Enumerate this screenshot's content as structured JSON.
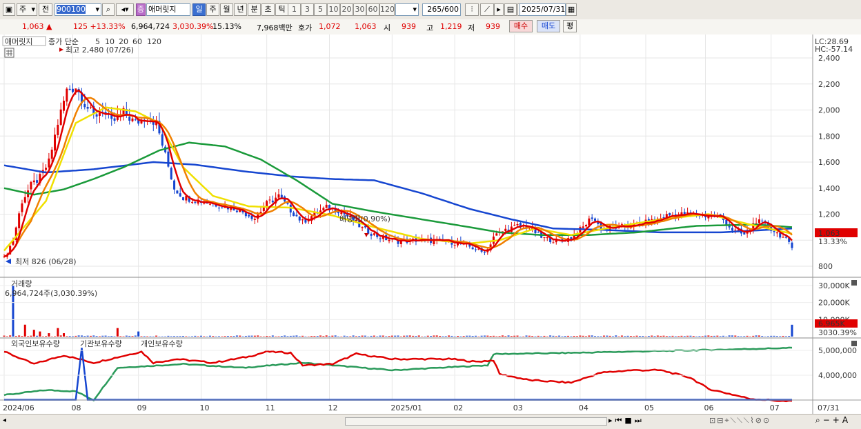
{
  "toolbar": {
    "period_options": [
      "주",
      "전"
    ],
    "code": "900100",
    "stock_tag": "증",
    "stock_name": "애머릿지",
    "intervals": [
      "일",
      "주",
      "월",
      "년",
      "분",
      "초",
      "틱"
    ],
    "numbers": [
      "1",
      "3",
      "5",
      "10",
      "20",
      "30",
      "60",
      "120"
    ],
    "count": "265",
    "count_total": "/600",
    "date": "2025/07/31"
  },
  "quote": {
    "price": "1,063 ▲",
    "change": "125 +13.33%",
    "volume": "6,964,724",
    "volume_ratio": "3,030.39%",
    "turnover": "15.13%",
    "amount": "7,968백만",
    "hoga_label": "호가",
    "ask": "1,072",
    "bid": "1,063",
    "open_label": "시",
    "open": "939",
    "high_label": "고",
    "high": "1,219",
    "low_label": "저",
    "low": "939",
    "buy_button": "매수",
    "sell_button": "매도",
    "eval_button": "평"
  },
  "price_panel": {
    "name_label": "애머릿지",
    "legend_label": "종가 단순",
    "ma_periods": [
      {
        "label": "5",
        "color": "#e00000"
      },
      {
        "label": "10",
        "color": "#f08000"
      },
      {
        "label": "20",
        "color": "#e8d800"
      },
      {
        "label": "60",
        "color": "#1a9a3a"
      },
      {
        "label": "120",
        "color": "#1646d0"
      }
    ],
    "high_annotation": "최고 2,480 (07/26)",
    "low_annotation": "최저 826 (06/28)",
    "dividend_annotation": "배당락(0.90%)",
    "lc_label": "LC:28.69",
    "hc_label": "HC:-57.14",
    "y_ticks": [
      "2,400",
      "2,200",
      "2,000",
      "1,800",
      "1,600",
      "1,400",
      "1,200",
      "800"
    ],
    "current_price_box": "1,063",
    "current_change_box": "13.33%"
  },
  "volume_panel": {
    "title": "거래량",
    "value_label": "6,964,724주(3,030.39%)",
    "y_ticks": [
      "30,000K",
      "20,000K",
      "10,000K"
    ],
    "current_box": "6,965K",
    "current_pct": "3030.39%"
  },
  "holding_panel": {
    "legends": [
      {
        "label": "외국인보유수량",
        "color": "#e00000"
      },
      {
        "label": "기관보유수량",
        "color": "#1646d0"
      },
      {
        "label": "개인보유수량",
        "color": "#1a9a3a"
      }
    ],
    "y_ticks": [
      "5,000,000",
      "4,000,000"
    ]
  },
  "x_axis": {
    "labels": [
      "2024/06",
      "08",
      "09",
      "10",
      "11",
      "12",
      "2025/01",
      "02",
      "03",
      "04",
      "05",
      "06",
      "07"
    ],
    "right_label": "07/31"
  },
  "chart_data": {
    "type": "candlestick",
    "y_range": [
      800,
      2480
    ],
    "current_price": 1063,
    "high": {
      "value": 2480,
      "date": "07/26"
    },
    "low": {
      "value": 826,
      "date": "06/28"
    },
    "close_anchors": [
      [
        0,
        860
      ],
      [
        3,
        1000
      ],
      [
        6,
        1300
      ],
      [
        9,
        1420
      ],
      [
        12,
        1480
      ],
      [
        15,
        1600
      ],
      [
        18,
        1900
      ],
      [
        21,
        2150
      ],
      [
        24,
        2180
      ],
      [
        27,
        2050
      ],
      [
        30,
        1950
      ],
      [
        33,
        2000
      ],
      [
        36,
        1900
      ],
      [
        40,
        1980
      ],
      [
        44,
        1900
      ],
      [
        48,
        1950
      ],
      [
        51,
        1900
      ],
      [
        54,
        1650
      ],
      [
        57,
        1400
      ],
      [
        60,
        1330
      ],
      [
        66,
        1300
      ],
      [
        72,
        1270
      ],
      [
        78,
        1240
      ],
      [
        84,
        1170
      ],
      [
        88,
        1280
      ],
      [
        92,
        1340
      ],
      [
        96,
        1230
      ],
      [
        100,
        1140
      ],
      [
        104,
        1200
      ],
      [
        108,
        1250
      ],
      [
        112,
        1230
      ],
      [
        116,
        1170
      ],
      [
        120,
        1090
      ],
      [
        126,
        1020
      ],
      [
        132,
        990
      ],
      [
        138,
        1000
      ],
      [
        144,
        995
      ],
      [
        150,
        985
      ],
      [
        155,
        960
      ],
      [
        160,
        910
      ],
      [
        162,
        930
      ],
      [
        164,
        1030
      ],
      [
        168,
        1080
      ],
      [
        172,
        1110
      ],
      [
        176,
        1100
      ],
      [
        180,
        1020
      ],
      [
        186,
        990
      ],
      [
        190,
        1020
      ],
      [
        194,
        1100
      ],
      [
        197,
        1180
      ],
      [
        200,
        1090
      ],
      [
        206,
        1100
      ],
      [
        212,
        1120
      ],
      [
        218,
        1150
      ],
      [
        222,
        1190
      ],
      [
        228,
        1200
      ],
      [
        234,
        1190
      ],
      [
        240,
        1180
      ],
      [
        244,
        1080
      ],
      [
        248,
        1040
      ],
      [
        252,
        1150
      ],
      [
        256,
        1100
      ],
      [
        260,
        1040
      ],
      [
        262,
        1000
      ],
      [
        264,
        940
      ]
    ],
    "volume_spikes": [
      [
        3,
        30000
      ],
      [
        7,
        7000
      ],
      [
        10,
        4000
      ],
      [
        12,
        3000
      ],
      [
        15,
        2000
      ],
      [
        18,
        5000
      ],
      [
        20,
        2000
      ],
      [
        38,
        5000
      ],
      [
        45,
        3000
      ],
      [
        264,
        6965
      ]
    ],
    "ma20_anchors": [
      [
        0,
        920
      ],
      [
        14,
        1300
      ],
      [
        24,
        1900
      ],
      [
        34,
        2020
      ],
      [
        44,
        1990
      ],
      [
        52,
        1900
      ],
      [
        60,
        1560
      ],
      [
        70,
        1340
      ],
      [
        82,
        1260
      ],
      [
        96,
        1250
      ],
      [
        110,
        1190
      ],
      [
        124,
        1100
      ],
      [
        140,
        1010
      ],
      [
        156,
        975
      ],
      [
        166,
        1000
      ],
      [
        178,
        1090
      ],
      [
        190,
        1040
      ],
      [
        204,
        1100
      ],
      [
        220,
        1160
      ],
      [
        236,
        1200
      ],
      [
        250,
        1120
      ],
      [
        264,
        1050
      ]
    ],
    "ma60_anchors": [
      [
        0,
        1400
      ],
      [
        10,
        1350
      ],
      [
        20,
        1390
      ],
      [
        30,
        1470
      ],
      [
        40,
        1560
      ],
      [
        52,
        1690
      ],
      [
        62,
        1750
      ],
      [
        74,
        1720
      ],
      [
        86,
        1620
      ],
      [
        98,
        1460
      ],
      [
        110,
        1280
      ],
      [
        124,
        1220
      ],
      [
        140,
        1160
      ],
      [
        156,
        1100
      ],
      [
        166,
        1060
      ],
      [
        180,
        1040
      ],
      [
        196,
        1040
      ],
      [
        212,
        1060
      ],
      [
        232,
        1110
      ],
      [
        252,
        1120
      ],
      [
        264,
        1100
      ]
    ],
    "ma120_anchors": [
      [
        0,
        1575
      ],
      [
        14,
        1520
      ],
      [
        30,
        1545
      ],
      [
        50,
        1600
      ],
      [
        64,
        1580
      ],
      [
        80,
        1530
      ],
      [
        96,
        1490
      ],
      [
        110,
        1470
      ],
      [
        124,
        1460
      ],
      [
        140,
        1360
      ],
      [
        156,
        1240
      ],
      [
        170,
        1160
      ],
      [
        184,
        1090
      ],
      [
        200,
        1080
      ],
      [
        220,
        1060
      ],
      [
        240,
        1060
      ],
      [
        264,
        1090
      ]
    ],
    "holding_foreign": [
      [
        0,
        4950
      ],
      [
        10,
        4450
      ],
      [
        20,
        4800
      ],
      [
        30,
        4500
      ],
      [
        40,
        4780
      ],
      [
        46,
        4950
      ],
      [
        50,
        4500
      ],
      [
        58,
        4650
      ],
      [
        70,
        4500
      ],
      [
        82,
        4750
      ],
      [
        88,
        4950
      ],
      [
        96,
        4900
      ],
      [
        100,
        4400
      ],
      [
        110,
        4450
      ],
      [
        118,
        4860
      ],
      [
        130,
        4650
      ],
      [
        150,
        4650
      ],
      [
        158,
        4540
      ],
      [
        164,
        4600
      ],
      [
        166,
        4050
      ],
      [
        176,
        3800
      ],
      [
        190,
        3700
      ],
      [
        200,
        4100
      ],
      [
        210,
        4200
      ],
      [
        220,
        4200
      ],
      [
        230,
        3900
      ],
      [
        236,
        3450
      ],
      [
        250,
        3050
      ],
      [
        262,
        2950
      ]
    ],
    "holding_individual": [
      [
        0,
        3200
      ],
      [
        14,
        3400
      ],
      [
        24,
        3350
      ],
      [
        30,
        3000
      ],
      [
        38,
        4300
      ],
      [
        60,
        4450
      ],
      [
        80,
        4300
      ],
      [
        100,
        4500
      ],
      [
        130,
        4200
      ],
      [
        162,
        4400
      ],
      [
        164,
        4850
      ],
      [
        190,
        4900
      ],
      [
        230,
        5000
      ],
      [
        264,
        5100
      ]
    ],
    "holding_institution": [
      [
        0,
        3010
      ],
      [
        24,
        3010
      ],
      [
        26,
        5100
      ],
      [
        28,
        3010
      ],
      [
        264,
        3010
      ]
    ]
  }
}
